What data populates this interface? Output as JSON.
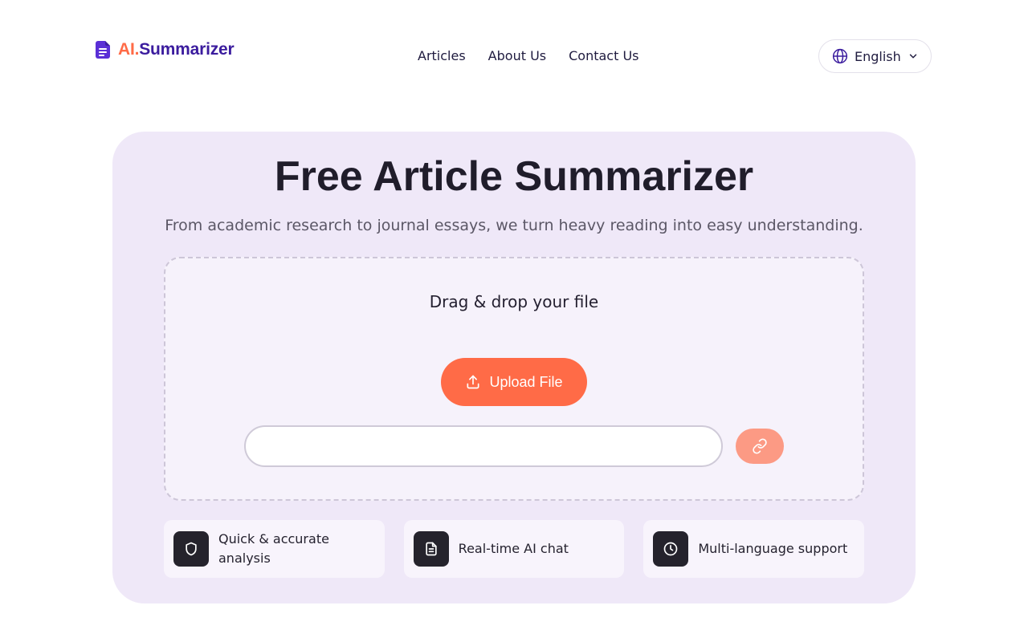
{
  "brand": {
    "prefix": "AI.",
    "name": "Summarizer",
    "prefix_color": "#ff6b47",
    "name_color": "#3b1c9e"
  },
  "nav": {
    "items": [
      "Articles",
      "About Us",
      "Contact Us"
    ]
  },
  "language": {
    "label": "English",
    "icon": "globe-icon"
  },
  "hero": {
    "title": "Free Article Summarizer",
    "subtitle": "From academic research to journal essays, we turn heavy reading into easy understanding."
  },
  "upload": {
    "drop_label": "Drag & drop your file",
    "button_label": "Upload File",
    "button_icon": "upload-icon",
    "url_placeholder": "",
    "url_value": "",
    "link_button_icon": "link-icon"
  },
  "features": [
    {
      "label": "Quick & accurate analysis",
      "icon": "shield-icon"
    },
    {
      "label": "Real-time AI chat",
      "icon": "document-icon"
    },
    {
      "label": "Multi-language support",
      "icon": "clock-icon"
    }
  ],
  "colors": {
    "accent": "#ff6b47",
    "accent_light": "#fc9a84",
    "card_bg": "#efe8f8",
    "brand_purple": "#3b1c9e",
    "icon_tile": "#25232c"
  }
}
